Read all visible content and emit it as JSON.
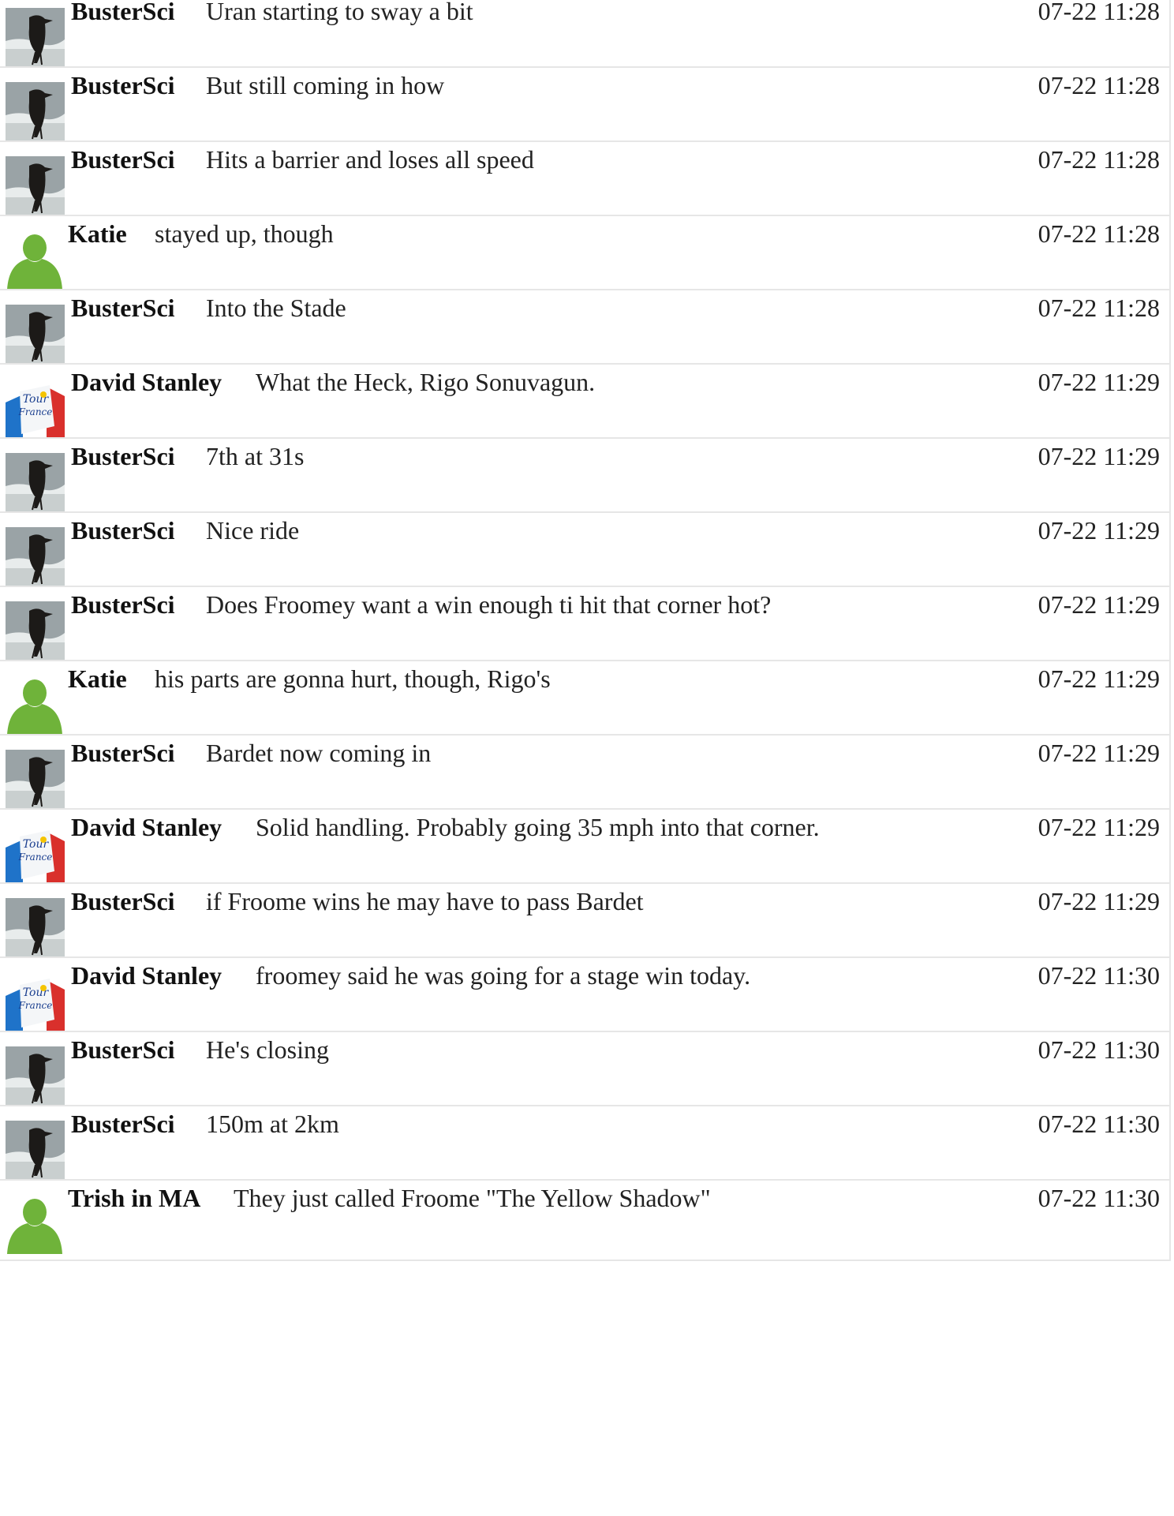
{
  "chat": {
    "messages": [
      {
        "user": "BusterSci",
        "text": "Uran starting to sway a bit",
        "time": "07-22 11:28",
        "avatar": "crow-avatar-icon"
      },
      {
        "user": "BusterSci",
        "text": "But still coming in how",
        "time": "07-22 11:28",
        "avatar": "crow-avatar-icon"
      },
      {
        "user": "BusterSci",
        "text": "Hits a barrier and loses all speed",
        "time": "07-22 11:28",
        "avatar": "crow-avatar-icon"
      },
      {
        "user": "Katie",
        "text": "stayed up, though",
        "time": "07-22 11:28",
        "avatar": "default-user-avatar-icon"
      },
      {
        "user": "BusterSci",
        "text": "Into the Stade",
        "time": "07-22 11:28",
        "avatar": "crow-avatar-icon"
      },
      {
        "user": "David Stanley",
        "text": "What the Heck, Rigo Sonuvagun.",
        "time": "07-22 11:29",
        "avatar": "tour-de-france-avatar-icon"
      },
      {
        "user": "BusterSci",
        "text": "7th at 31s",
        "time": "07-22 11:29",
        "avatar": "crow-avatar-icon"
      },
      {
        "user": "BusterSci",
        "text": "Nice ride",
        "time": "07-22 11:29",
        "avatar": "crow-avatar-icon"
      },
      {
        "user": "BusterSci",
        "text": "Does Froomey want a win enough ti hit that corner hot?",
        "time": "07-22 11:29",
        "avatar": "crow-avatar-icon"
      },
      {
        "user": "Katie",
        "text": "his parts are gonna hurt, though, Rigo's",
        "time": "07-22 11:29",
        "avatar": "default-user-avatar-icon"
      },
      {
        "user": "BusterSci",
        "text": "Bardet now coming in",
        "time": "07-22 11:29",
        "avatar": "crow-avatar-icon"
      },
      {
        "user": "David Stanley",
        "text": "Solid handling. Probably going 35 mph into that corner.",
        "time": "07-22 11:29",
        "avatar": "tour-de-france-avatar-icon"
      },
      {
        "user": "BusterSci",
        "text": "if Froome wins he may have to pass Bardet",
        "time": "07-22 11:29",
        "avatar": "crow-avatar-icon"
      },
      {
        "user": "David Stanley",
        "text": "froomey said he was going for a stage win today.",
        "time": "07-22 11:30",
        "avatar": "tour-de-france-avatar-icon"
      },
      {
        "user": "BusterSci",
        "text": "He's closing",
        "time": "07-22 11:30",
        "avatar": "crow-avatar-icon"
      },
      {
        "user": "BusterSci",
        "text": "150m at 2km",
        "time": "07-22 11:30",
        "avatar": "crow-avatar-icon"
      },
      {
        "user": "Trish in MA",
        "text": "They just called Froome \"The Yellow Shadow\"",
        "time": "07-22 11:30",
        "avatar": "default-user-avatar-icon"
      }
    ]
  }
}
